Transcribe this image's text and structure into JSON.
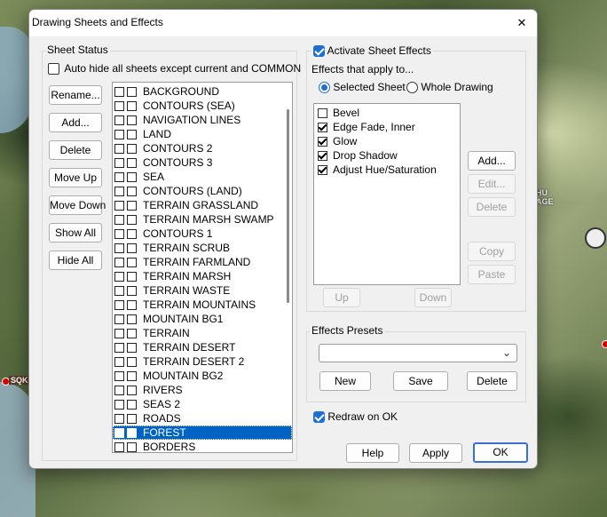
{
  "window": {
    "title": "Drawing Sheets and Effects",
    "close_glyph": "✕"
  },
  "background_map": {
    "label_left": "SQK",
    "label_right_line1": "HU",
    "label_right_line2": "AGE"
  },
  "sheet_status": {
    "group_label": "Sheet Status",
    "auto_hide_label": "Auto hide all sheets except current and COMMON",
    "auto_hide_checked": false,
    "buttons": {
      "rename": "Rename...",
      "add": "Add...",
      "delete": "Delete",
      "move_up": "Move Up",
      "move_down": "Move Down",
      "show_all": "Show All",
      "hide_all": "Hide All"
    },
    "sheets": [
      "BACKGROUND",
      "CONTOURS (SEA)",
      "NAVIGATION LINES",
      "LAND",
      "CONTOURS 2",
      "CONTOURS 3",
      "SEA",
      "CONTOURS (LAND)",
      "TERRAIN GRASSLAND",
      "TERRAIN MARSH SWAMP",
      "CONTOURS 1",
      "TERRAIN SCRUB",
      "TERRAIN FARMLAND",
      "TERRAIN MARSH",
      "TERRAIN WASTE",
      "TERRAIN MOUNTAINS",
      "MOUNTAIN BG1",
      "TERRAIN",
      "TERRAIN DESERT",
      "TERRAIN DESERT 2",
      "MOUNTAIN BG2",
      "RIVERS",
      "SEAS 2",
      "ROADS",
      "FOREST",
      "BORDERS"
    ],
    "selected_sheet": "FOREST"
  },
  "effects": {
    "activate_label": "Activate Sheet Effects",
    "activate_checked": true,
    "apply_to_label": "Effects that apply to...",
    "scope_selected_sheet": "Selected Sheet",
    "scope_whole_drawing": "Whole Drawing",
    "scope_value": "Selected Sheet",
    "items": [
      {
        "label": "Bevel",
        "checked": false
      },
      {
        "label": "Edge Fade, Inner",
        "checked": true
      },
      {
        "label": "Glow",
        "checked": true
      },
      {
        "label": "Drop Shadow",
        "checked": true
      },
      {
        "label": "Adjust Hue/Saturation",
        "checked": true
      }
    ],
    "buttons": {
      "add": "Add...",
      "edit": "Edit...",
      "delete": "Delete",
      "copy": "Copy",
      "paste": "Paste",
      "up": "Up",
      "down": "Down"
    }
  },
  "presets": {
    "group_label": "Effects Presets",
    "selected": "",
    "new": "New",
    "save": "Save",
    "delete": "Delete"
  },
  "redraw": {
    "label": "Redraw on OK",
    "checked": true
  },
  "footer": {
    "help": "Help",
    "apply": "Apply",
    "ok": "OK"
  },
  "colors": {
    "selection": "#0063c3",
    "accent": "#1f6fd1"
  }
}
